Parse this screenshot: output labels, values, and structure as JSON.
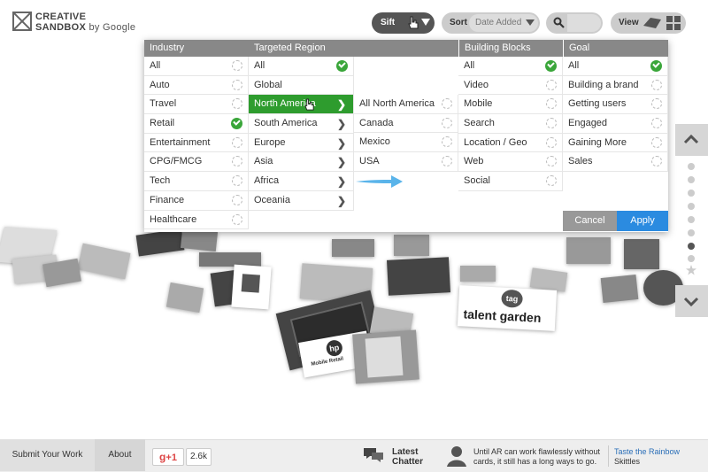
{
  "header": {
    "logo_line1": "CREATIVE",
    "logo_line2": "SANDBOX",
    "logo_by": "by Google",
    "sift_label": "Sift",
    "sort_label": "Sort",
    "sort_value": "Date Added",
    "view_label": "View"
  },
  "filters": {
    "industry": {
      "header": "Industry",
      "items": [
        {
          "label": "All",
          "state": "circle"
        },
        {
          "label": "Auto",
          "state": "circle"
        },
        {
          "label": "Travel",
          "state": "circle"
        },
        {
          "label": "Retail",
          "state": "check"
        },
        {
          "label": "Entertainment",
          "state": "circle"
        },
        {
          "label": "CPG/FMCG",
          "state": "circle"
        },
        {
          "label": "Tech",
          "state": "circle"
        },
        {
          "label": "Finance",
          "state": "circle"
        },
        {
          "label": "Healthcare",
          "state": "circle"
        }
      ]
    },
    "region": {
      "header": "Targeted Region",
      "items": [
        {
          "label": "All",
          "state": "check"
        },
        {
          "label": "Global",
          "state": "none"
        },
        {
          "label": "North America",
          "state": "chevron",
          "selected": true
        },
        {
          "label": "South America",
          "state": "chevron"
        },
        {
          "label": "Europe",
          "state": "chevron"
        },
        {
          "label": "Asia",
          "state": "chevron"
        },
        {
          "label": "Africa",
          "state": "chevron"
        },
        {
          "label": "Oceania",
          "state": "chevron"
        }
      ],
      "sub_items": [
        {
          "label": ""
        },
        {
          "label": ""
        },
        {
          "label": "All North America",
          "state": "circle"
        },
        {
          "label": "Canada",
          "state": "circle"
        },
        {
          "label": "Mexico",
          "state": "circle"
        },
        {
          "label": "USA",
          "state": "circle"
        }
      ]
    },
    "blocks": {
      "header": "Building Blocks",
      "items": [
        {
          "label": "All",
          "state": "check"
        },
        {
          "label": "Video",
          "state": "circle"
        },
        {
          "label": "Mobile",
          "state": "circle"
        },
        {
          "label": "Search",
          "state": "circle"
        },
        {
          "label": "Location / Geo",
          "state": "circle"
        },
        {
          "label": "Web",
          "state": "circle"
        },
        {
          "label": "Social",
          "state": "circle"
        }
      ]
    },
    "goal": {
      "header": "Goal",
      "items": [
        {
          "label": "All",
          "state": "check"
        },
        {
          "label": "Building a brand",
          "state": "circle"
        },
        {
          "label": "Getting users",
          "state": "circle"
        },
        {
          "label": "Engaged",
          "state": "circle"
        },
        {
          "label": "Gaining More",
          "state": "circle"
        },
        {
          "label": "Sales",
          "state": "circle"
        }
      ]
    },
    "cancel_label": "Cancel",
    "apply_label": "Apply"
  },
  "cards": {
    "talent_line1": "tag",
    "talent_line2": "talent garden",
    "hp_label": "Mobile Retail"
  },
  "footer": {
    "submit_label": "Submit Your Work",
    "about_label": "About",
    "gplus_label": "+1",
    "gplus_count": "2.6k",
    "chatter_line1": "Latest",
    "chatter_line2": "Chatter",
    "quote_line1": "Until AR can work flawlessly without",
    "quote_line2": "cards, it still has a long ways to go.",
    "link_label": "Taste the Rainbow",
    "link_source": "Skittles"
  },
  "colors": {
    "selected_green": "#2e9c2e",
    "check_green": "#3aa63a",
    "apply_blue": "#2b8be0",
    "arrow_blue": "#5ab4ea"
  }
}
